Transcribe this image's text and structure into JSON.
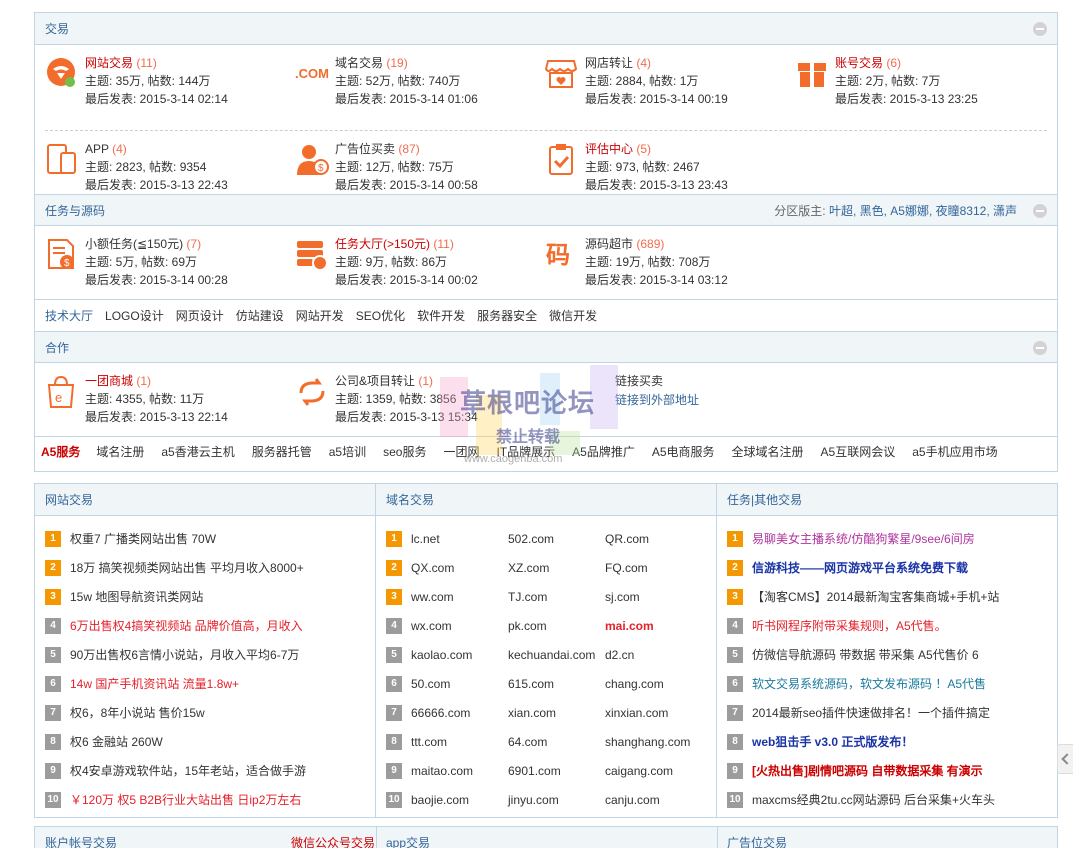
{
  "sections": {
    "trade": {
      "title": "交易",
      "forums": [
        {
          "name": "网站交易",
          "count": "(11)",
          "topics": "主题: 35万, 帖数: 144万",
          "last": "最后发表: 2015-3-14 02:14",
          "icon": "chat-bubble-icon",
          "red": true
        },
        {
          "name": "域名交易",
          "count": "(19)",
          "topics": "主题: 52万, 帖数: 740万",
          "last": "最后发表: 2015-3-14 01:06",
          "icon": "dotcom-icon",
          "red": false
        },
        {
          "name": "网店转让",
          "count": "(4)",
          "topics": "主题: 2884, 帖数: 1万",
          "last": "最后发表: 2015-3-14 00:19",
          "icon": "shop-icon",
          "red": false
        },
        {
          "name": "账号交易",
          "count": "(6)",
          "topics": "主题: 2万, 帖数: 7万",
          "last": "最后发表: 2015-3-13 23:25",
          "icon": "gift-box-icon",
          "red": true
        },
        {
          "name": "APP",
          "count": "(4)",
          "topics": "主题: 2823, 帖数: 9354",
          "last": "最后发表: 2015-3-13 22:43",
          "icon": "devices-icon",
          "red": false
        },
        {
          "name": "广告位买卖",
          "count": "(87)",
          "topics": "主题: 12万, 帖数: 75万",
          "last": "最后发表: 2015-3-14 00:58",
          "icon": "user-dollar-icon",
          "red": false
        },
        {
          "name": "评估中心",
          "count": "(5)",
          "topics": "主题: 973, 帖数: 2467",
          "last": "最后发表: 2015-3-13 23:43",
          "icon": "clipboard-check-icon",
          "red": true
        }
      ]
    },
    "task": {
      "title": "任务与源码",
      "moderators_label": "分区版主:",
      "moderators": "叶超, 黑色, A5娜娜, 夜瞳8312, 潇声",
      "forums": [
        {
          "name": "小额任务(≦150元)",
          "count": "(7)",
          "topics": "主题: 5万, 帖数: 69万",
          "last": "最后发表: 2015-3-14 00:28",
          "icon": "coin-doc-icon",
          "red": false
        },
        {
          "name": "任务大厅(>150元)",
          "count": "(11)",
          "topics": "主题: 9万, 帖数: 86万",
          "last": "最后发表: 2015-3-14 00:02",
          "icon": "server-coin-icon",
          "red": true
        },
        {
          "name": "源码超市",
          "count": "(689)",
          "topics": "主题: 19万, 帖数: 708万",
          "last": "最后发表: 2015-3-14 03:12",
          "icon": "code-char-icon",
          "red": false
        }
      ],
      "links": [
        "技术大厅",
        "LOGO设计",
        "网页设计",
        "仿站建设",
        "网站开发",
        "SEO优化",
        "软件开发",
        "服务器安全",
        "微信开发"
      ]
    },
    "coop": {
      "title": "合作",
      "forums": [
        {
          "name": "一团商城",
          "count": "(1)",
          "topics": "主题: 4355, 帖数: 11万",
          "last": "最后发表: 2015-3-13 22:14",
          "icon": "shopping-bag-icon",
          "red": true
        },
        {
          "name": "公司&项目转让",
          "count": "(1)",
          "topics": "主题: 1359, 帖数: 3856",
          "last": "最后发表: 2015-3-13 15:34",
          "icon": "transfer-arrows-icon",
          "red": false
        }
      ],
      "link_forum": {
        "name": "链接买卖",
        "sub": "链接到外部地址"
      },
      "a5_links": [
        "A5服务",
        "域名注册",
        "a5香港云主机",
        "服务器托管",
        "a5培训",
        "seo服务",
        "一团网",
        "IT品牌展示",
        "A5品牌推广",
        "A5电商服务",
        "全球域名注册",
        "A5互联网会议",
        "a5手机应用市场"
      ]
    }
  },
  "watermark": {
    "line1": "草根吧论坛",
    "line2": "禁止转载",
    "url": "www.caogenba.com"
  },
  "lists": {
    "site": {
      "title": "网站交易",
      "items": [
        {
          "n": "1",
          "text": "权重7 广播类网站出售 70W",
          "style": "dark"
        },
        {
          "n": "2",
          "text": "18万 搞笑视频类网站出售 平均月收入8000+",
          "style": "dark"
        },
        {
          "n": "3",
          "text": "15w 地图导航资讯类网站",
          "style": "dark"
        },
        {
          "n": "4",
          "text": "6万出售权4搞笑视频站 品牌价值高，月收入",
          "style": "red"
        },
        {
          "n": "5",
          "text": "90万出售权6言情小说站，月收入平均6-7万",
          "style": "dark"
        },
        {
          "n": "6",
          "text": "14w 国产手机资讯站 流量1.8w+",
          "style": "red"
        },
        {
          "n": "7",
          "text": "权6，8年小说站 售价15w",
          "style": "dark"
        },
        {
          "n": "8",
          "text": "权6 金融站 260W",
          "style": "dark"
        },
        {
          "n": "9",
          "text": "权4安卓游戏软件站，15年老站，适合做手游",
          "style": "dark"
        },
        {
          "n": "10",
          "text": "￥120万 权5 B2B行业大站出售 日ip2万左右",
          "style": "red"
        }
      ]
    },
    "domain": {
      "title": "域名交易",
      "rows": [
        {
          "n": "1",
          "a": "lc.net",
          "b": "502.com",
          "c": "QR.com",
          "c_red": false
        },
        {
          "n": "2",
          "a": "QX.com",
          "b": "XZ.com",
          "c": "FQ.com",
          "c_red": false
        },
        {
          "n": "3",
          "a": "ww.com",
          "b": "TJ.com",
          "c": "sj.com",
          "c_red": false
        },
        {
          "n": "4",
          "a": "wx.com",
          "b": "pk.com",
          "c": "mai.com",
          "c_red": true
        },
        {
          "n": "5",
          "a": "kaolao.com",
          "b": "kechuandai.com",
          "c": "d2.cn",
          "c_red": false
        },
        {
          "n": "6",
          "a": "50.com",
          "b": "615.com",
          "c": "chang.com",
          "c_red": false
        },
        {
          "n": "7",
          "a": "66666.com",
          "b": "xian.com",
          "c": "xinxian.com",
          "c_red": false
        },
        {
          "n": "8",
          "a": "ttt.com",
          "b": "64.com",
          "c": "shanghang.com",
          "c_red": false
        },
        {
          "n": "9",
          "a": "maitao.com",
          "b": "6901.com",
          "c": "caigang.com",
          "c_red": false
        },
        {
          "n": "10",
          "a": "baojie.com",
          "b": "jinyu.com",
          "c": "canju.com",
          "c_red": false
        }
      ]
    },
    "other": {
      "title": "任务|其他交易",
      "items": [
        {
          "n": "1",
          "text": "易聊美女主播系统/仿酷狗繁星/9see/6间房",
          "style": "purple"
        },
        {
          "n": "2",
          "text": "信游科技——网页游戏平台系统免费下载",
          "style": "navy"
        },
        {
          "n": "3",
          "text": "【淘客CMS】2014最新淘宝客集商城+手机+站",
          "style": "dark"
        },
        {
          "n": "4",
          "text": "听书网程序附带采集规则，A5代售。",
          "style": "red"
        },
        {
          "n": "5",
          "text": "仿微信导航源码 带数据 带采集 A5代售价 6",
          "style": "dark"
        },
        {
          "n": "6",
          "text": "软文交易系统源码，软文发布源码 ！A5代售",
          "style": "teal"
        },
        {
          "n": "7",
          "text": "2014最新seo插件快速做排名！一个插件搞定",
          "style": "dark"
        },
        {
          "n": "8",
          "text": "web狙击手 v3.0 正式版发布！",
          "style": "navy"
        },
        {
          "n": "9",
          "text": "[火热出售]剧情吧源码 自带数据采集 有演示",
          "style": "bred"
        },
        {
          "n": "10",
          "text": "maxcms经典2tu.cc网站源码 后台采集+火车头",
          "style": "dark"
        }
      ]
    }
  },
  "bottom": {
    "h1": "账户帐号交易",
    "h1b": "微信公众号交易",
    "h2": "app交易",
    "h3": "广告位交易"
  }
}
